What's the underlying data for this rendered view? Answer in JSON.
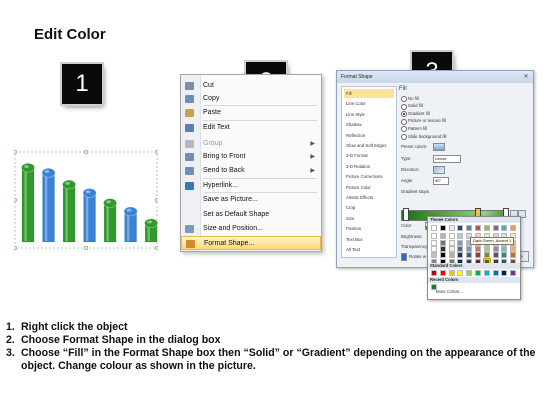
{
  "title": "Edit Color",
  "badges": [
    "1",
    "2",
    "3"
  ],
  "chart": {
    "colors": {
      "green": "#2f9a2a",
      "blue": "#3b82d6"
    },
    "bars": [
      {
        "color": "green",
        "level": 0.92
      },
      {
        "color": "blue",
        "level": 0.86
      },
      {
        "color": "green",
        "level": 0.72
      },
      {
        "color": "blue",
        "level": 0.62
      },
      {
        "color": "green",
        "level": 0.5
      },
      {
        "color": "blue",
        "level": 0.4
      },
      {
        "color": "green",
        "level": 0.26
      }
    ]
  },
  "context_menu": {
    "items": [
      {
        "label": "Cut",
        "icon": "scissors-icon",
        "color": "#7a8ea6"
      },
      {
        "label": "Copy",
        "icon": "copy-icon",
        "color": "#6f8fb8"
      },
      {
        "label": "Paste",
        "icon": "paste-icon",
        "color": "#c9a24a"
      },
      {
        "label": "Edit Text",
        "icon": "edit-text-icon",
        "color": "#5b7fb2"
      },
      {
        "label": "Group",
        "icon": "group-icon",
        "color": "#b8b8b8",
        "arrow": "▶",
        "disabled": true
      },
      {
        "label": "Bring to Front",
        "icon": "bring-to-front-icon",
        "color": "#6f8fb8",
        "arrow": "▶"
      },
      {
        "label": "Send to Back",
        "icon": "send-to-back-icon",
        "color": "#6f8fb8",
        "arrow": "▶"
      },
      {
        "label": "Hyperlink...",
        "icon": "hyperlink-icon",
        "color": "#3a76b8"
      },
      {
        "label": "Save as Picture...",
        "icon": "",
        "color": ""
      },
      {
        "label": "Set as Default Shape",
        "icon": "",
        "color": ""
      },
      {
        "label": "Size and Position...",
        "icon": "size-position-icon",
        "color": "#7a9bc4"
      },
      {
        "label": "Format Shape...",
        "icon": "format-shape-icon",
        "color": "#d28a2d",
        "highlighted": true
      }
    ]
  },
  "dialog": {
    "title": "Format Shape",
    "close": "✕",
    "nav": [
      "Fill",
      "Line Color",
      "Line Style",
      "Shadow",
      "Reflection",
      "Glow and Soft Edges",
      "3-D Format",
      "3-D Rotation",
      "Picture Corrections",
      "Picture Color",
      "Artistic Effects",
      "Crop",
      "Size",
      "Position",
      "Text Box",
      "Alt Text"
    ],
    "fill_heading": "Fill",
    "options": [
      {
        "label": "No fill",
        "on": false
      },
      {
        "label": "Solid fill",
        "on": false
      },
      {
        "label": "Gradient fill",
        "on": true
      },
      {
        "label": "Picture or texture fill",
        "on": false
      },
      {
        "label": "Pattern fill",
        "on": false
      },
      {
        "label": "Slide background fill",
        "on": false
      }
    ],
    "preset_label": "Preset colors:",
    "type_label": "Type:",
    "type_value": "Linear",
    "direction_label": "Direction:",
    "angle_label": "Angle:",
    "angle_value": "90°",
    "stops_label": "Gradient stops",
    "color_label": "Color",
    "position_label": "Position:",
    "position_value": "74%",
    "brightness_label": "Brightness:",
    "transparency_label": "Transparency:",
    "rotate_label": "Rotate w",
    "close_button": "Close"
  },
  "color_popup": {
    "theme_header": "Theme Colors",
    "tooltip": "Dark Green, Accent 1",
    "standard_header": "Standard Colors",
    "recent_header": "Recent Colors",
    "more": "More Colors...",
    "theme_top": [
      "#ffffff",
      "#000000",
      "#eeece1",
      "#1f497d",
      "#4f81bd",
      "#c0504d",
      "#9bbb59",
      "#8064a2",
      "#4bacc6",
      "#f79646"
    ],
    "standard": [
      "#c00000",
      "#ff0000",
      "#ffc000",
      "#ffff00",
      "#92d050",
      "#00b050",
      "#00b0f0",
      "#0070c0",
      "#002060",
      "#7030a0"
    ],
    "recent": [
      "#1e7b1e"
    ]
  },
  "instructions": [
    {
      "num": "1.",
      "text": "Right click the object"
    },
    {
      "num": "2.",
      "text": "Choose Format Shape in the dialog box"
    },
    {
      "num": "3.",
      "text": "Choose “Fill” in the Format Shape box then “Solid” or “Gradient” depending on the appearance of the object. Change colour as shown in the picture."
    }
  ]
}
